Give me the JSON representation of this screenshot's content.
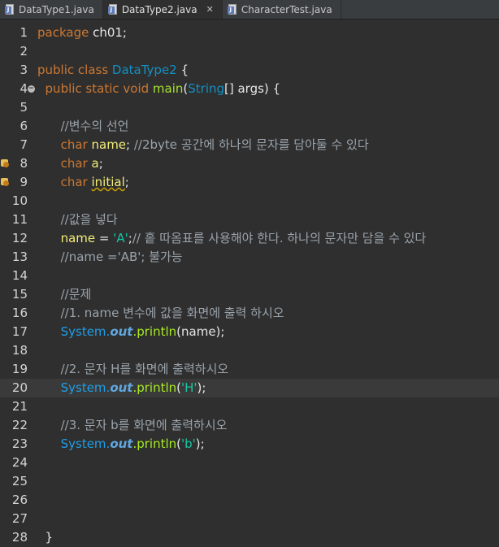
{
  "tabs": [
    {
      "label": "DataType1.java",
      "active": false,
      "closable": false
    },
    {
      "label": "DataType2.java",
      "active": true,
      "closable": true
    },
    {
      "label": "CharacterTest.java",
      "active": false,
      "closable": false
    }
  ],
  "close_glyph": "✕",
  "lines": [
    {
      "n": "1",
      "parts": [
        [
          "kw",
          "package "
        ],
        [
          "plain",
          "ch01;"
        ]
      ]
    },
    {
      "n": "2",
      "parts": []
    },
    {
      "n": "3",
      "parts": [
        [
          "kw",
          "public class "
        ],
        [
          "cls",
          "DataType2"
        ],
        [
          "plain",
          " {"
        ]
      ]
    },
    {
      "n": "4",
      "fold": true,
      "parts": [
        [
          "kw",
          "  public static void "
        ],
        [
          "fn",
          "main"
        ],
        [
          "plain",
          "("
        ],
        [
          "cls",
          "String"
        ],
        [
          "plain",
          "[] args) {"
        ]
      ]
    },
    {
      "n": "5",
      "parts": []
    },
    {
      "n": "6",
      "parts": [
        [
          "cmt",
          "      //변수의 선언"
        ]
      ]
    },
    {
      "n": "7",
      "parts": [
        [
          "kw",
          "      char "
        ],
        [
          "var",
          "name"
        ],
        [
          "plain",
          "; "
        ],
        [
          "cmt",
          "//2byte 공간에 하나의 문자를 담아둘 수 있다"
        ]
      ]
    },
    {
      "n": "8",
      "marker": true,
      "parts": [
        [
          "kw",
          "      char "
        ],
        [
          "var",
          "a"
        ],
        [
          "plain",
          ";"
        ]
      ]
    },
    {
      "n": "9",
      "marker": true,
      "parts": [
        [
          "kw",
          "      char "
        ],
        [
          "var warn",
          "initial"
        ],
        [
          "plain",
          ";"
        ]
      ]
    },
    {
      "n": "10",
      "parts": []
    },
    {
      "n": "11",
      "parts": [
        [
          "cmt",
          "      //값을 넣다"
        ]
      ]
    },
    {
      "n": "12",
      "parts": [
        [
          "var",
          "      name"
        ],
        [
          "plain",
          " = "
        ],
        [
          "str",
          "'A'"
        ],
        [
          "plain",
          ";"
        ],
        [
          "cmt",
          "// 홑 따옴표를 사용해야 한다. 하나의 문자만 담을 수 있다"
        ]
      ]
    },
    {
      "n": "13",
      "parts": [
        [
          "cmt",
          "      //name ='AB'; 불가능"
        ]
      ]
    },
    {
      "n": "14",
      "parts": []
    },
    {
      "n": "15",
      "parts": [
        [
          "cmt",
          "      //문제"
        ]
      ]
    },
    {
      "n": "16",
      "parts": [
        [
          "cmt",
          "      //1. name 변수에 값을 화면에 출력 하시오"
        ]
      ]
    },
    {
      "n": "17",
      "parts": [
        [
          "sys",
          "      System."
        ],
        [
          "out",
          "out"
        ],
        [
          "meth",
          ".println"
        ],
        [
          "plain",
          "(name);"
        ]
      ]
    },
    {
      "n": "18",
      "parts": []
    },
    {
      "n": "19",
      "parts": [
        [
          "cmt",
          "      //2. 문자 H를 화면에 출력하시오"
        ]
      ]
    },
    {
      "n": "20",
      "current": true,
      "parts": [
        [
          "sys",
          "      System."
        ],
        [
          "out",
          "out"
        ],
        [
          "meth",
          ".println"
        ],
        [
          "plain",
          "("
        ],
        [
          "str",
          "'H'"
        ],
        [
          "plain",
          ");"
        ]
      ]
    },
    {
      "n": "21",
      "parts": []
    },
    {
      "n": "22",
      "parts": [
        [
          "cmt",
          "      //3. 문자 b를 화면에 출력하시오"
        ]
      ]
    },
    {
      "n": "23",
      "parts": [
        [
          "sys",
          "      System."
        ],
        [
          "out",
          "out"
        ],
        [
          "meth",
          ".println"
        ],
        [
          "plain",
          "("
        ],
        [
          "str",
          "'b'"
        ],
        [
          "plain",
          ");"
        ]
      ]
    },
    {
      "n": "24",
      "parts": []
    },
    {
      "n": "25",
      "parts": []
    },
    {
      "n": "26",
      "parts": []
    },
    {
      "n": "27",
      "parts": []
    },
    {
      "n": "28",
      "parts": [
        [
          "plain",
          "  }"
        ]
      ]
    }
  ]
}
